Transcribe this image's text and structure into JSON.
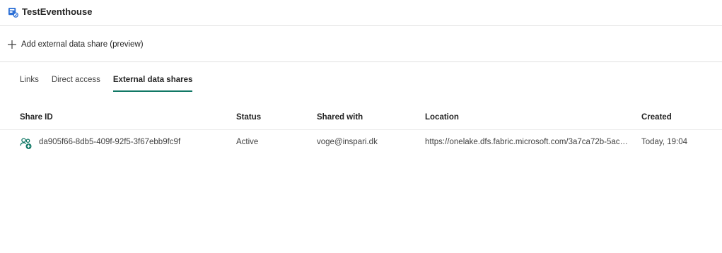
{
  "header": {
    "title": "TestEventhouse",
    "icon": "eventhouse-icon"
  },
  "toolbar": {
    "add_label": "Add external data share (preview)",
    "add_icon": "plus-icon"
  },
  "tabs": [
    {
      "label": "Links",
      "active": false
    },
    {
      "label": "Direct access",
      "active": false
    },
    {
      "label": "External data shares",
      "active": true
    }
  ],
  "table": {
    "columns": [
      "Share ID",
      "Status",
      "Shared with",
      "Location",
      "Created"
    ],
    "rows": [
      {
        "icon": "share-user-add-icon",
        "share_id": "da905f66-8db5-409f-92f5-3f67ebb9fc9f",
        "status": "Active",
        "shared_with": "voge@inspari.dk",
        "location": "https://onelake.dfs.fabric.microsoft.com/3a7ca72b-5ac2-44a...",
        "created": "Today, 19:04"
      }
    ]
  },
  "colors": {
    "accent": "#117865",
    "brand_icon": "#1a73c7",
    "text": "#242424",
    "border": "#e0e0e0"
  }
}
